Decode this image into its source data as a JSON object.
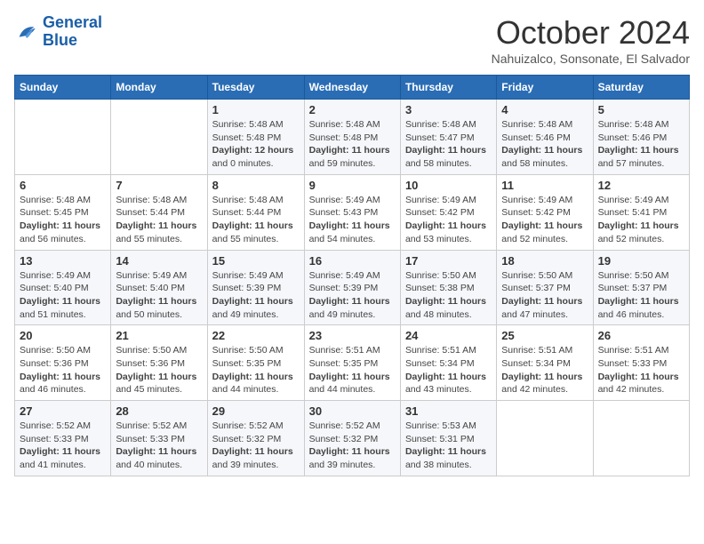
{
  "logo": {
    "line1": "General",
    "line2": "Blue"
  },
  "title": "October 2024",
  "location": "Nahuizalco, Sonsonate, El Salvador",
  "days_of_week": [
    "Sunday",
    "Monday",
    "Tuesday",
    "Wednesday",
    "Thursday",
    "Friday",
    "Saturday"
  ],
  "weeks": [
    [
      {
        "day": "",
        "content": ""
      },
      {
        "day": "",
        "content": ""
      },
      {
        "day": "1",
        "content": "Sunrise: 5:48 AM\nSunset: 5:48 PM\nDaylight: 12 hours\nand 0 minutes."
      },
      {
        "day": "2",
        "content": "Sunrise: 5:48 AM\nSunset: 5:48 PM\nDaylight: 11 hours\nand 59 minutes."
      },
      {
        "day": "3",
        "content": "Sunrise: 5:48 AM\nSunset: 5:47 PM\nDaylight: 11 hours\nand 58 minutes."
      },
      {
        "day": "4",
        "content": "Sunrise: 5:48 AM\nSunset: 5:46 PM\nDaylight: 11 hours\nand 58 minutes."
      },
      {
        "day": "5",
        "content": "Sunrise: 5:48 AM\nSunset: 5:46 PM\nDaylight: 11 hours\nand 57 minutes."
      }
    ],
    [
      {
        "day": "6",
        "content": "Sunrise: 5:48 AM\nSunset: 5:45 PM\nDaylight: 11 hours\nand 56 minutes."
      },
      {
        "day": "7",
        "content": "Sunrise: 5:48 AM\nSunset: 5:44 PM\nDaylight: 11 hours\nand 55 minutes."
      },
      {
        "day": "8",
        "content": "Sunrise: 5:48 AM\nSunset: 5:44 PM\nDaylight: 11 hours\nand 55 minutes."
      },
      {
        "day": "9",
        "content": "Sunrise: 5:49 AM\nSunset: 5:43 PM\nDaylight: 11 hours\nand 54 minutes."
      },
      {
        "day": "10",
        "content": "Sunrise: 5:49 AM\nSunset: 5:42 PM\nDaylight: 11 hours\nand 53 minutes."
      },
      {
        "day": "11",
        "content": "Sunrise: 5:49 AM\nSunset: 5:42 PM\nDaylight: 11 hours\nand 52 minutes."
      },
      {
        "day": "12",
        "content": "Sunrise: 5:49 AM\nSunset: 5:41 PM\nDaylight: 11 hours\nand 52 minutes."
      }
    ],
    [
      {
        "day": "13",
        "content": "Sunrise: 5:49 AM\nSunset: 5:40 PM\nDaylight: 11 hours\nand 51 minutes."
      },
      {
        "day": "14",
        "content": "Sunrise: 5:49 AM\nSunset: 5:40 PM\nDaylight: 11 hours\nand 50 minutes."
      },
      {
        "day": "15",
        "content": "Sunrise: 5:49 AM\nSunset: 5:39 PM\nDaylight: 11 hours\nand 49 minutes."
      },
      {
        "day": "16",
        "content": "Sunrise: 5:49 AM\nSunset: 5:39 PM\nDaylight: 11 hours\nand 49 minutes."
      },
      {
        "day": "17",
        "content": "Sunrise: 5:50 AM\nSunset: 5:38 PM\nDaylight: 11 hours\nand 48 minutes."
      },
      {
        "day": "18",
        "content": "Sunrise: 5:50 AM\nSunset: 5:37 PM\nDaylight: 11 hours\nand 47 minutes."
      },
      {
        "day": "19",
        "content": "Sunrise: 5:50 AM\nSunset: 5:37 PM\nDaylight: 11 hours\nand 46 minutes."
      }
    ],
    [
      {
        "day": "20",
        "content": "Sunrise: 5:50 AM\nSunset: 5:36 PM\nDaylight: 11 hours\nand 46 minutes."
      },
      {
        "day": "21",
        "content": "Sunrise: 5:50 AM\nSunset: 5:36 PM\nDaylight: 11 hours\nand 45 minutes."
      },
      {
        "day": "22",
        "content": "Sunrise: 5:50 AM\nSunset: 5:35 PM\nDaylight: 11 hours\nand 44 minutes."
      },
      {
        "day": "23",
        "content": "Sunrise: 5:51 AM\nSunset: 5:35 PM\nDaylight: 11 hours\nand 44 minutes."
      },
      {
        "day": "24",
        "content": "Sunrise: 5:51 AM\nSunset: 5:34 PM\nDaylight: 11 hours\nand 43 minutes."
      },
      {
        "day": "25",
        "content": "Sunrise: 5:51 AM\nSunset: 5:34 PM\nDaylight: 11 hours\nand 42 minutes."
      },
      {
        "day": "26",
        "content": "Sunrise: 5:51 AM\nSunset: 5:33 PM\nDaylight: 11 hours\nand 42 minutes."
      }
    ],
    [
      {
        "day": "27",
        "content": "Sunrise: 5:52 AM\nSunset: 5:33 PM\nDaylight: 11 hours\nand 41 minutes."
      },
      {
        "day": "28",
        "content": "Sunrise: 5:52 AM\nSunset: 5:33 PM\nDaylight: 11 hours\nand 40 minutes."
      },
      {
        "day": "29",
        "content": "Sunrise: 5:52 AM\nSunset: 5:32 PM\nDaylight: 11 hours\nand 39 minutes."
      },
      {
        "day": "30",
        "content": "Sunrise: 5:52 AM\nSunset: 5:32 PM\nDaylight: 11 hours\nand 39 minutes."
      },
      {
        "day": "31",
        "content": "Sunrise: 5:53 AM\nSunset: 5:31 PM\nDaylight: 11 hours\nand 38 minutes."
      },
      {
        "day": "",
        "content": ""
      },
      {
        "day": "",
        "content": ""
      }
    ]
  ]
}
